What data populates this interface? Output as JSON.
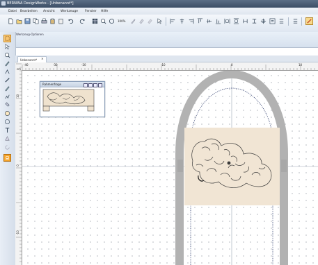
{
  "window": {
    "title": "BERNINA DesignWorks - [Unbenannt*]"
  },
  "menu": [
    "Datei",
    "Bearbeiten",
    "Ansicht",
    "Werkzeuge",
    "Fenster",
    "Hilfe"
  ],
  "toolbar": {
    "zoom_label": "100%"
  },
  "options_bar": {
    "label": "Werkzeug-Optionen"
  },
  "document": {
    "tab_label": "Unbenannt*",
    "tab_close": "×",
    "corner_label": "cm 3"
  },
  "ruler_h": [
    "-40",
    "-30",
    "-20",
    "-10",
    "0",
    "10"
  ],
  "ruler_v": [
    "10",
    "0",
    "-10"
  ],
  "overview": {
    "title": "Rahmenfrage"
  },
  "colors": {
    "accent": "#f0a030",
    "hoop": "#b2b2b2",
    "background_design": "#f1e5d4",
    "selection": "#4a5a8a"
  }
}
